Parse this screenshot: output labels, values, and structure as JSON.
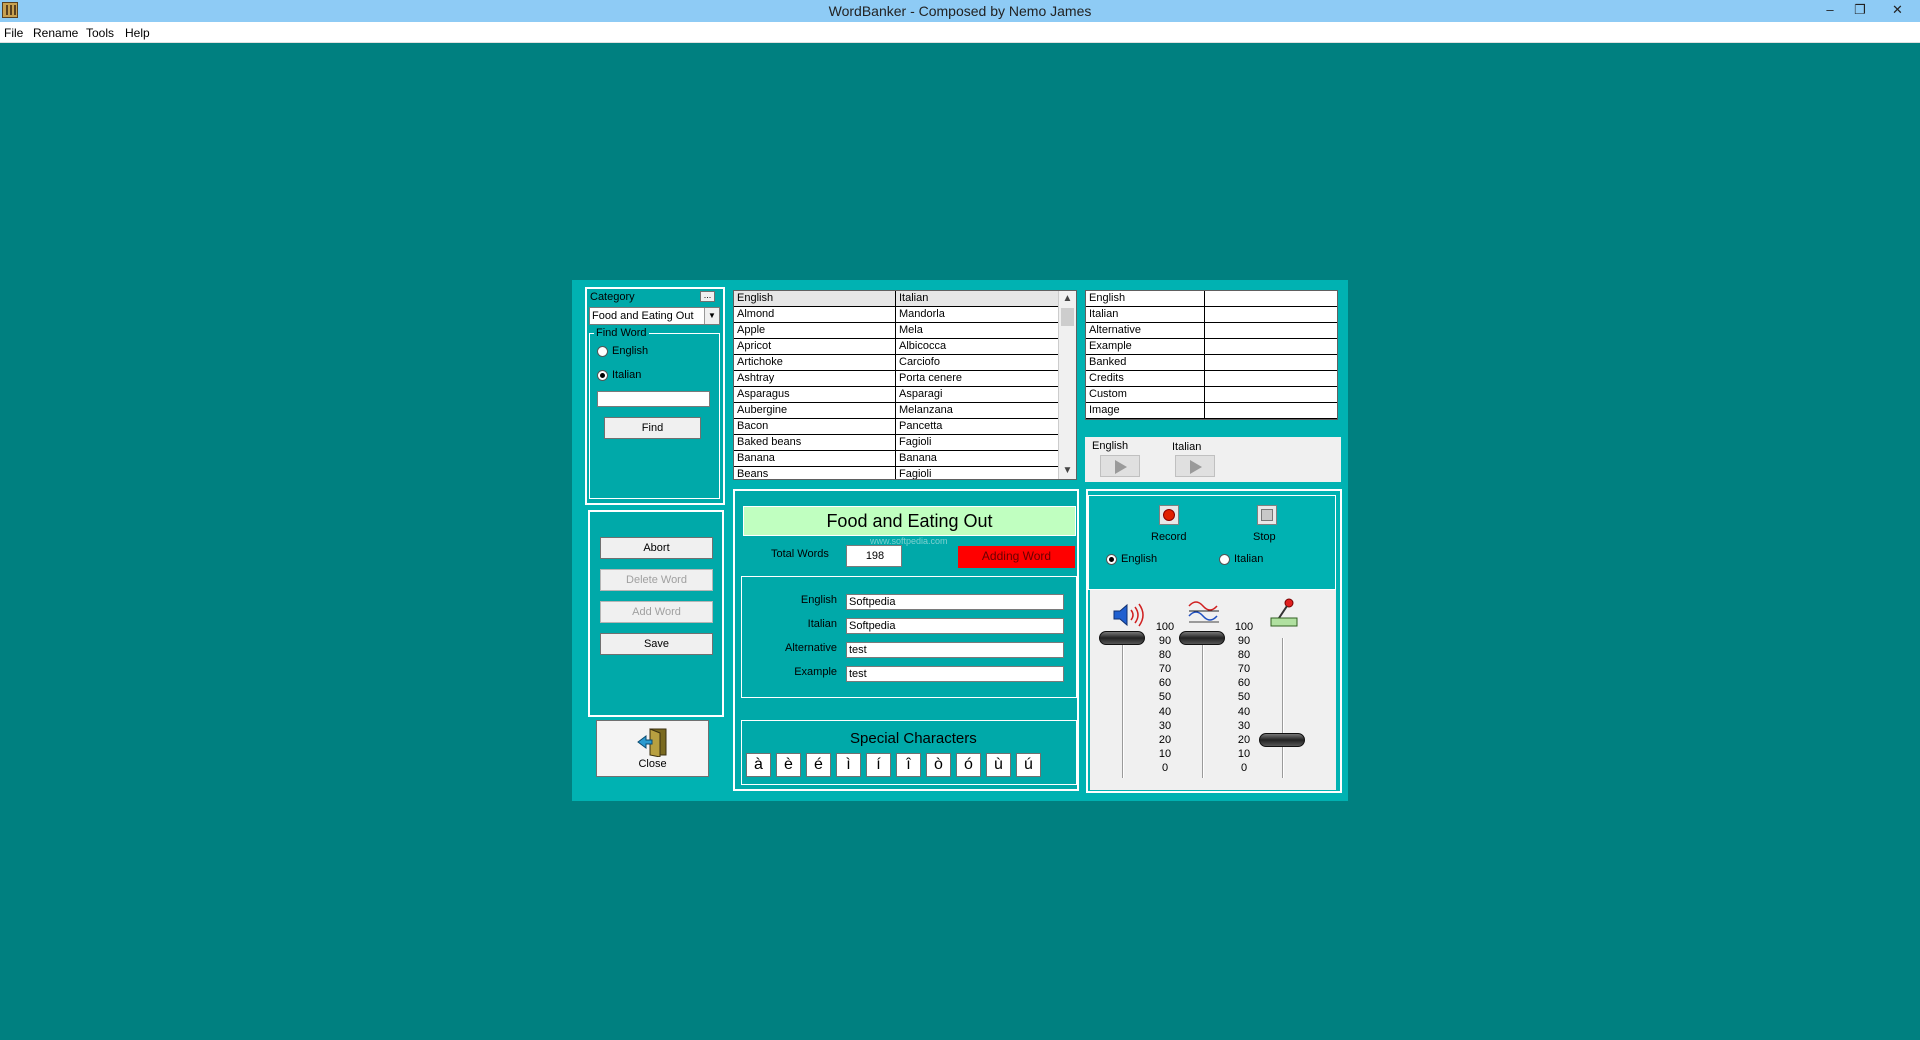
{
  "window": {
    "title": "WordBanker - Composed by Nemo James",
    "minimize": "–",
    "restore": "❐",
    "close": "✕"
  },
  "menu": [
    "File",
    "Rename",
    "Tools",
    "Help"
  ],
  "category": {
    "label": "Category",
    "more": "...",
    "selected": "Food and Eating Out"
  },
  "find": {
    "legend": "Find Word",
    "english": "English",
    "italian": "Italian",
    "selected": "Italian",
    "value": "",
    "button": "Find"
  },
  "actions": {
    "abort": "Abort",
    "delete": "Delete Word",
    "add": "Add Word",
    "save": "Save"
  },
  "close_label": "Close",
  "wordlist": {
    "headers": [
      "English",
      "Italian"
    ],
    "rows": [
      [
        "Almond",
        "Mandorla"
      ],
      [
        "Apple",
        "Mela"
      ],
      [
        "Apricot",
        "Albicocca"
      ],
      [
        "Artichoke",
        "Carciofo"
      ],
      [
        "Ashtray",
        "Porta cenere"
      ],
      [
        "Asparagus",
        "Asparagi"
      ],
      [
        "Aubergine",
        "Melanzana"
      ],
      [
        "Bacon",
        "Pancetta"
      ],
      [
        "Baked beans",
        "Fagioli"
      ],
      [
        "Banana",
        "Banana"
      ],
      [
        "Beans",
        "Fagioli"
      ]
    ],
    "scroll_up": "▲",
    "scroll_down": "▼"
  },
  "details": [
    "English",
    "Italian",
    "Alternative",
    "Example",
    "Banked",
    "Credits",
    "Custom",
    "Image"
  ],
  "playback": {
    "english": "English",
    "italian": "Italian"
  },
  "editor": {
    "title": "Food and Eating Out",
    "total_label": "Total Words",
    "total_value": "198",
    "status": "Adding Word",
    "fields": [
      {
        "label": "English",
        "value": "Softpedia"
      },
      {
        "label": "Italian",
        "value": "Softpedia"
      },
      {
        "label": "Alternative",
        "value": "test"
      },
      {
        "label": "Example",
        "value": "test"
      }
    ]
  },
  "special": {
    "title": "Special Characters",
    "chars": [
      "à",
      "è",
      "é",
      "ì",
      "í",
      "î",
      "ò",
      "ó",
      "ù",
      "ú"
    ]
  },
  "recorder": {
    "record": "Record",
    "stop": "Stop",
    "english": "English",
    "italian": "Italian",
    "selected": "English"
  },
  "mixer": {
    "scale": [
      "100",
      "90",
      "80",
      "70",
      "60",
      "50",
      "40",
      "30",
      "20",
      "10",
      "0"
    ],
    "sliders": [
      {
        "name": "volume",
        "icon": "speaker-icon",
        "level": 100
      },
      {
        "name": "wave",
        "icon": "wave-icon",
        "level": 100
      },
      {
        "name": "mic",
        "icon": "microphone-icon",
        "level": 20
      }
    ]
  },
  "watermark": "www.softpedia.com",
  "colors": {
    "background": "#008080",
    "frame": "#00b2b2",
    "banner": "#c0ffc0",
    "status": "#ff0000"
  }
}
